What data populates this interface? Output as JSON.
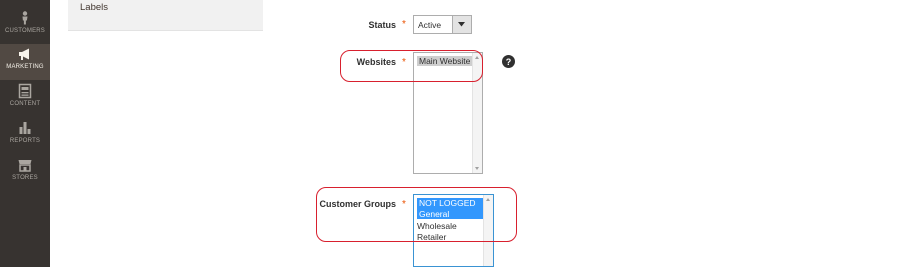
{
  "sidebar": {
    "items": [
      {
        "label": "CUSTOMERS",
        "icon": "customers-icon",
        "active": false
      },
      {
        "label": "MARKETING",
        "icon": "marketing-icon",
        "active": true
      },
      {
        "label": "CONTENT",
        "icon": "content-icon",
        "active": false
      },
      {
        "label": "REPORTS",
        "icon": "reports-icon",
        "active": false
      },
      {
        "label": "STORES",
        "icon": "stores-icon",
        "active": false
      }
    ]
  },
  "left_panel": {
    "tab_label": "Labels"
  },
  "form": {
    "status": {
      "label": "Status",
      "required_mark": "*",
      "value": "Active"
    },
    "websites": {
      "label": "Websites",
      "required_mark": "*",
      "options": [
        "Main Website"
      ],
      "selected": "Main Website"
    },
    "customer_groups": {
      "label": "Customer Groups",
      "required_mark": "*",
      "options": [
        "NOT LOGGED IN",
        "General",
        "Wholesale",
        "Retailer"
      ],
      "selected": [
        "NOT LOGGED IN",
        "General"
      ]
    },
    "help_icon": "?"
  },
  "colors": {
    "sidebar_bg": "#373330",
    "sidebar_active": "#514943",
    "required": "#eb5202",
    "selection_blue": "#3297fd",
    "annotation_red": "#d8202e"
  }
}
